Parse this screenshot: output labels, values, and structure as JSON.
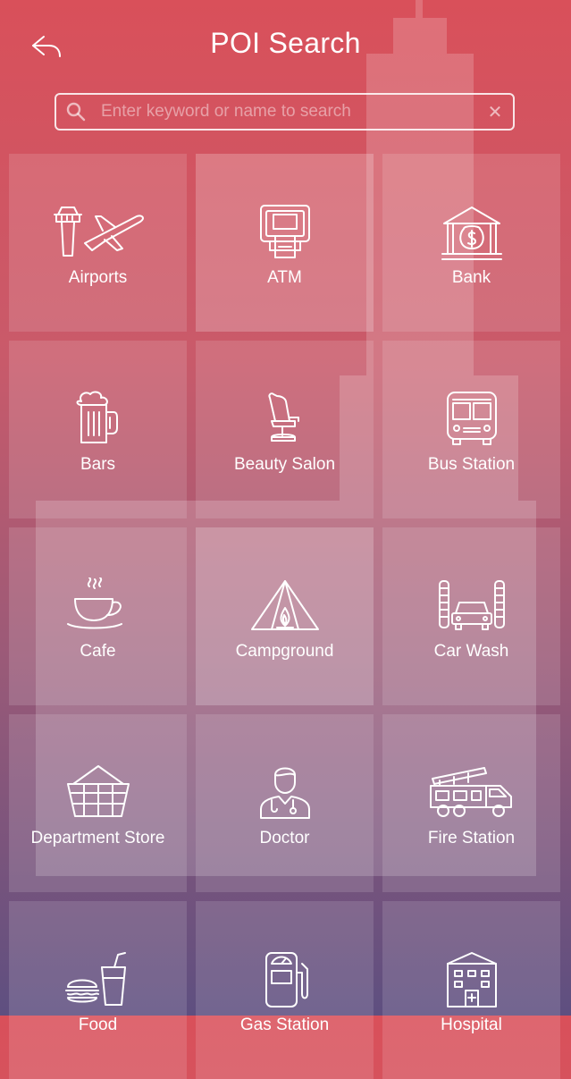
{
  "header": {
    "title": "POI Search"
  },
  "search": {
    "placeholder": "Enter keyword or name to search",
    "value": ""
  },
  "categories": [
    {
      "label": "Airports",
      "icon": "airport-icon"
    },
    {
      "label": "ATM",
      "icon": "atm-icon"
    },
    {
      "label": "Bank",
      "icon": "bank-icon"
    },
    {
      "label": "Bars",
      "icon": "beer-mug-icon"
    },
    {
      "label": "Beauty Salon",
      "icon": "salon-chair-icon"
    },
    {
      "label": "Bus Station",
      "icon": "bus-icon"
    },
    {
      "label": "Cafe",
      "icon": "coffee-cup-icon"
    },
    {
      "label": "Campground",
      "icon": "tent-icon"
    },
    {
      "label": "Car Wash",
      "icon": "car-wash-icon"
    },
    {
      "label": "Department Store",
      "icon": "basket-icon"
    },
    {
      "label": "Doctor",
      "icon": "doctor-icon"
    },
    {
      "label": "Fire Station",
      "icon": "fire-truck-icon"
    },
    {
      "label": "Food",
      "icon": "burger-drink-icon"
    },
    {
      "label": "Gas Station",
      "icon": "fuel-pump-icon"
    },
    {
      "label": "Hospital",
      "icon": "hospital-icon"
    }
  ]
}
